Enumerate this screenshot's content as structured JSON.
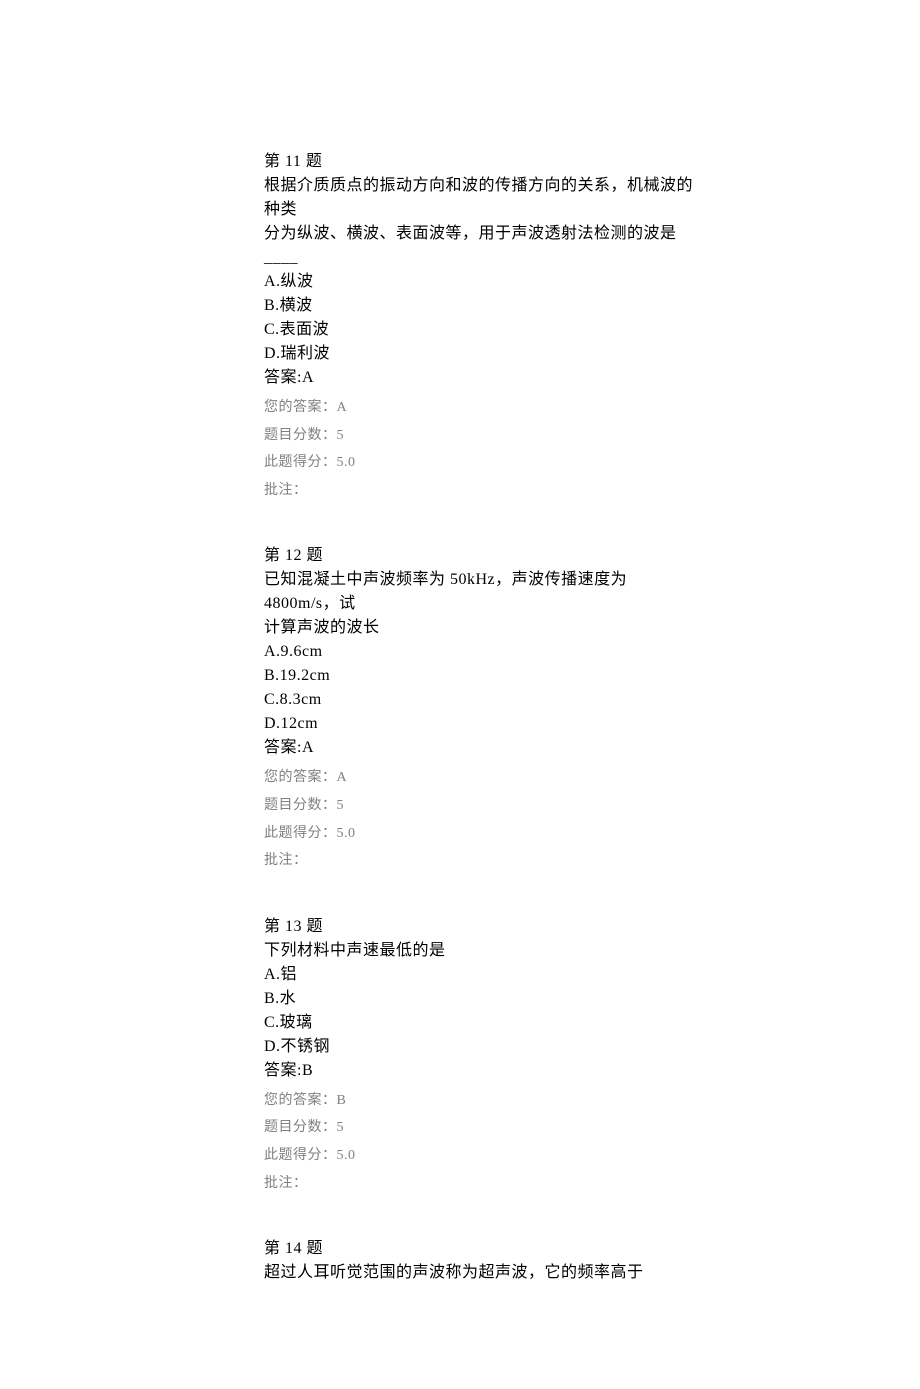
{
  "questions": [
    {
      "number": "第 11 题",
      "stem_line1": "根据介质质点的振动方向和波的传播方向的关系，机械波的种类",
      "stem_line2": "分为纵波、横波、表面波等，用于声波透射法检测的波是____",
      "optA": "A.纵波",
      "optB": "B.横波",
      "optC": "C.表面波",
      "optD": "D.瑞利波",
      "answer": "答案:A",
      "your_answer": "您的答案：A",
      "max_score": "题目分数：5",
      "got_score": "此题得分：5.0",
      "remark": "批注："
    },
    {
      "number": "第 12 题",
      "stem_line1": "已知混凝土中声波频率为 50kHz，声波传播速度为 4800m/s，试",
      "stem_line2": "计算声波的波长",
      "optA": "A.9.6cm",
      "optB": "B.19.2cm",
      "optC": "C.8.3cm",
      "optD": "D.12cm",
      "answer": "答案:A",
      "your_answer": "您的答案：A",
      "max_score": "题目分数：5",
      "got_score": "此题得分：5.0",
      "remark": "批注："
    },
    {
      "number": "第 13 题",
      "stem_line1": "下列材料中声速最低的是",
      "stem_line2": "",
      "optA": "A.铝",
      "optB": "B.水",
      "optC": "C.玻璃",
      "optD": "D.不锈钢",
      "answer": "答案:B",
      "your_answer": "您的答案：B",
      "max_score": "题目分数：5",
      "got_score": "此题得分：5.0",
      "remark": "批注："
    },
    {
      "number": "第 14 题",
      "stem_line1": "超过人耳听觉范围的声波称为超声波，它的频率高于",
      "stem_line2": "",
      "optA": "",
      "optB": "",
      "optC": "",
      "optD": "",
      "answer": "",
      "your_answer": "",
      "max_score": "",
      "got_score": "",
      "remark": ""
    }
  ]
}
